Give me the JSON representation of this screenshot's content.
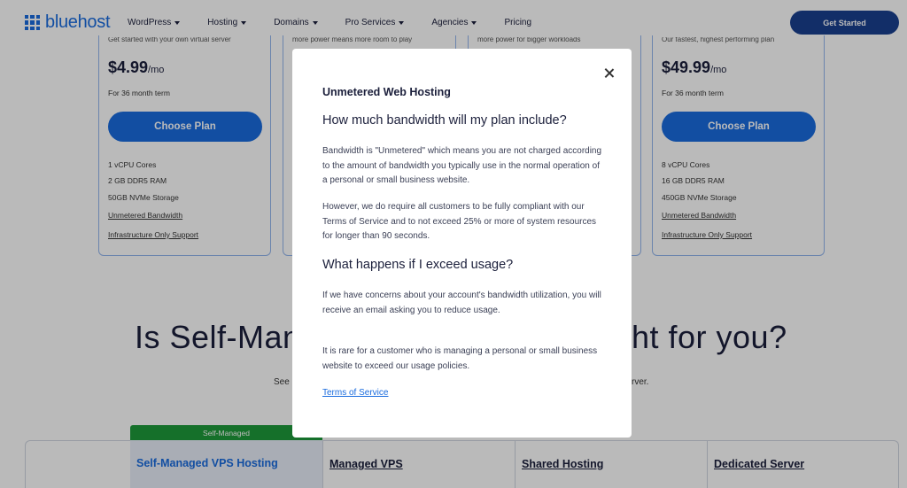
{
  "nav": {
    "logo": "bluehost",
    "items": [
      {
        "label": "WordPress",
        "dropdown": true
      },
      {
        "label": "Hosting",
        "dropdown": true
      },
      {
        "label": "Domains",
        "dropdown": true
      },
      {
        "label": "Pro Services",
        "dropdown": true
      },
      {
        "label": "Agencies",
        "dropdown": true
      },
      {
        "label": "Pricing",
        "dropdown": false
      }
    ],
    "cta": "Get Started"
  },
  "plans": [
    {
      "cut_text": "Get started with your own virtual server",
      "price": "$4.99",
      "per": "/mo",
      "term": "For 36 month term",
      "button": "Choose Plan",
      "features": [
        "1 vCPU Cores",
        "2 GB DDR5 RAM",
        "50GB NVMe Storage"
      ],
      "links": [
        "Unmetered Bandwidth",
        "Infrastructure Only Support"
      ]
    },
    {
      "cut_text": "more power means more room to play"
    },
    {
      "cut_text": "more power for bigger workloads"
    },
    {
      "cut_text": "Our fastest, highest performing plan",
      "price": "$49.99",
      "per": "/mo",
      "term": "For 36 month term",
      "button": "Choose Plan",
      "features": [
        "8 vCPU Cores",
        "16 GB DDR5 RAM",
        "450GB NVMe Storage"
      ],
      "links": [
        "Unmetered Bandwidth",
        "Infrastructure Only Support"
      ]
    }
  ],
  "section": {
    "heading_left": "Is Self-Man",
    "heading_right": "ht for you?",
    "sub_left": "See",
    "sub_right": "rver."
  },
  "compare": {
    "badge": "Self-Managed",
    "columns": [
      "Self-Managed VPS Hosting",
      "Managed VPS",
      "Shared Hosting",
      "Dedicated Server"
    ]
  },
  "modal": {
    "title": "Unmetered Web Hosting",
    "q1": "How much bandwidth will my plan include?",
    "p1": "Bandwidth is \"Unmetered\" which means you are not charged according to the amount of bandwidth you typically use in the normal operation of a personal or small business website.",
    "p2": "However, we do require all customers to be fully compliant with our Terms of Service and to not exceed 25% or more of system resources for longer than 90 seconds.",
    "q2": "What happens if I exceed usage?",
    "p3": "If we have concerns about your account's bandwidth utilization, you will receive an email asking you to reduce usage.",
    "p4": "It is rare for a customer who is managing a personal or small business website to exceed our usage policies.",
    "link": "Terms of Service"
  },
  "colors": {
    "brand_blue": "#196bde",
    "navy": "#1a3f8f",
    "badge_green": "#1e9a3a"
  }
}
